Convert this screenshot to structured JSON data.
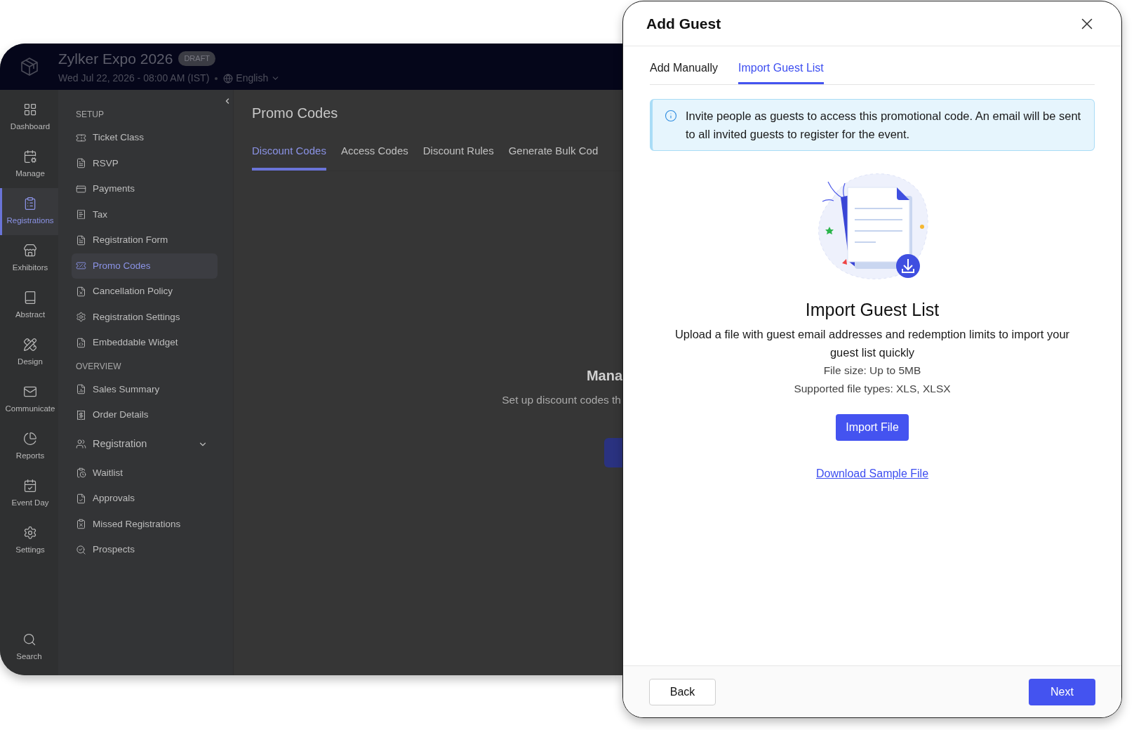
{
  "app": {
    "event_title": "Zylker Expo 2026",
    "status_badge": "DRAFT",
    "datetime": "Wed Jul 22, 2026 - 08:00 AM (IST)",
    "language": "English",
    "rail": [
      {
        "label": "Dashboard",
        "selected": false
      },
      {
        "label": "Manage",
        "selected": false
      },
      {
        "label": "Registrations",
        "selected": true
      },
      {
        "label": "Exhibitors",
        "selected": false
      },
      {
        "label": "Abstract",
        "selected": false
      },
      {
        "label": "Design",
        "selected": false
      },
      {
        "label": "Communicate",
        "selected": false
      },
      {
        "label": "Reports",
        "selected": false
      },
      {
        "label": "Event Day",
        "selected": false
      },
      {
        "label": "Settings",
        "selected": false
      }
    ],
    "rail_search": "Search",
    "submenu": [
      {
        "heading": "SETUP",
        "items": [
          {
            "label": "Ticket Class",
            "selected": false
          },
          {
            "label": "RSVP",
            "selected": false
          },
          {
            "label": "Payments",
            "selected": false
          },
          {
            "label": "Tax",
            "selected": false
          },
          {
            "label": "Registration Form",
            "selected": false
          },
          {
            "label": "Promo Codes",
            "selected": true
          },
          {
            "label": "Cancellation Policy",
            "selected": false
          },
          {
            "label": "Registration Settings",
            "selected": false
          },
          {
            "label": "Embeddable Widget",
            "selected": false
          }
        ]
      },
      {
        "heading": "OVERVIEW",
        "items": [
          {
            "label": "Sales Summary",
            "selected": false
          },
          {
            "label": "Order Details",
            "selected": false
          },
          {
            "label": "Registration",
            "selected": false,
            "expanded": false
          },
          {
            "label": "Waitlist",
            "selected": false
          },
          {
            "label": "Approvals",
            "selected": false
          },
          {
            "label": "Missed Registrations",
            "selected": false
          },
          {
            "label": "Prospects",
            "selected": false
          }
        ]
      }
    ],
    "page_title": "Promo Codes",
    "tabs": [
      {
        "label": "Discount Codes",
        "selected": true
      },
      {
        "label": "Access Codes",
        "selected": false
      },
      {
        "label": "Discount Rules",
        "selected": false
      },
      {
        "label": "Generate Bulk Cod",
        "selected": false
      }
    ],
    "empty_state": {
      "title": "Mana",
      "text": "Set up discount codes th"
    }
  },
  "modal": {
    "title": "Add Guest",
    "tabs": [
      {
        "label": "Add Manually",
        "selected": false
      },
      {
        "label": "Import Guest List",
        "selected": true
      }
    ],
    "info": "Invite people as guests to access this promotional code. An email will be sent to all invited guests to register for the event.",
    "heading": "Import Guest List",
    "description": "Upload a file with guest email addresses and redemption limits to import your guest list quickly",
    "file_size": "File size: Up to 5MB",
    "file_types": "Supported file types: XLS, XLSX",
    "import_button": "Import File",
    "download_link": "Download Sample File",
    "back_button": "Back",
    "next_button": "Next"
  }
}
